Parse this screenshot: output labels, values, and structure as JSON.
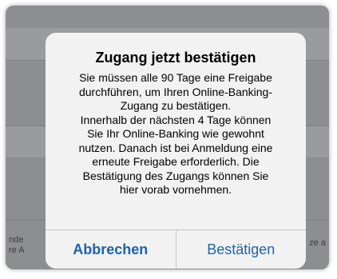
{
  "background": {
    "left_text": "nde\nre A",
    "right_text": "ze a"
  },
  "dialog": {
    "title": "Zugang jetzt bestätigen",
    "message": "Sie müssen alle 90 Tage eine Freigabe\ndurchführen, um Ihren Online-Banking-\nZugang zu bestätigen.\nInnerhalb der nächsten 4 Tage können\nSie Ihr Online-Banking wie gewohnt\nnutzen. Danach ist bei Anmeldung eine\nerneute Freigabe erforderlich. Die\nBestätigung des Zugangs können Sie\nhier vorab vornehmen.",
    "cancel_label": "Abbrechen",
    "confirm_label": "Bestätigen"
  },
  "colors": {
    "accent": "#1b63b3",
    "dialog_background": "#f2f2f2",
    "overlay": "#8d8e91"
  }
}
